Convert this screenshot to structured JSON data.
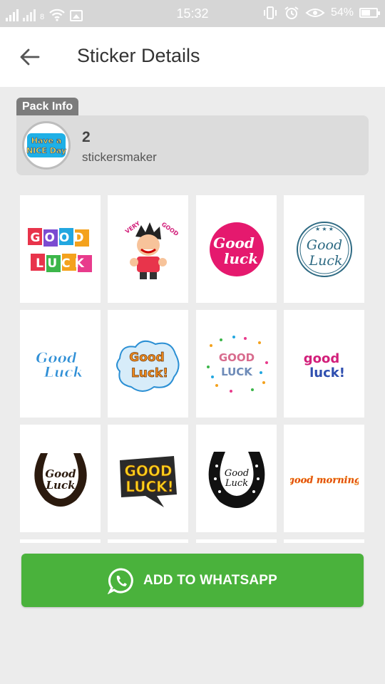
{
  "status_bar": {
    "time": "15:32",
    "battery": "54%",
    "sim_label": "8",
    "icons": [
      "signal-icon",
      "signal-icon",
      "wifi-icon",
      "gallery-icon",
      "vibrate-icon",
      "alarm-icon",
      "eye-icon",
      "battery-icon"
    ]
  },
  "toolbar": {
    "title": "Sticker Details",
    "back_icon": "arrow-left-icon"
  },
  "pack": {
    "tag_label": "Pack Info",
    "name": "2",
    "publisher": "stickersmaker",
    "icon_text_line1": "Have a",
    "icon_text_line2": "NICE Day"
  },
  "stickers": [
    {
      "text1": "GOOD",
      "text2": "LUCK",
      "style": "tags"
    },
    {
      "text1": "VERY",
      "text2": "GOOD",
      "style": "cartoon"
    },
    {
      "text1": "Good",
      "text2": "luck",
      "style": "pink-circle"
    },
    {
      "text1": "Good",
      "text2": "Luck",
      "style": "outline-circle"
    },
    {
      "text1": "Good",
      "text2": "Luck",
      "style": "blue-script"
    },
    {
      "text1": "Good",
      "text2": "Luck!",
      "style": "orange-cloud"
    },
    {
      "text1": "GOOD",
      "text2": "LUCK",
      "style": "confetti"
    },
    {
      "text1": "good",
      "text2": "luck!",
      "style": "colorful"
    },
    {
      "text1": "Good",
      "text2": "Luck",
      "style": "horseshoe-brown"
    },
    {
      "text1": "GOOD",
      "text2": "LUCK!",
      "style": "yellow-bubble"
    },
    {
      "text1": "Good",
      "text2": "Luck",
      "style": "horseshoe-black"
    },
    {
      "text1": "good morning",
      "text2": "",
      "style": "red-script"
    }
  ],
  "add_button": {
    "label": "ADD TO WHATSAPP",
    "icon": "whatsapp-icon"
  },
  "colors": {
    "accent_green": "#4ab23c",
    "background": "#ececec",
    "pack_tag": "#7c7c7c"
  }
}
